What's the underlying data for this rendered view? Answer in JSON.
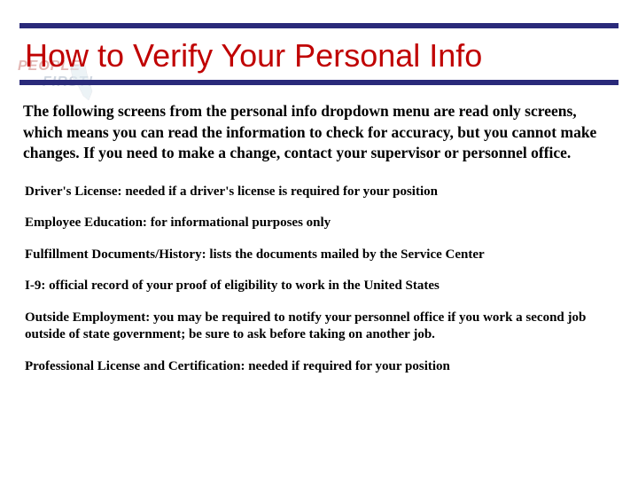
{
  "watermark": {
    "line1": "PEOPLE",
    "line2": "FIRST!"
  },
  "title": "How to Verify Your Personal Info",
  "intro": "The following screens from the personal info dropdown menu are read only screens, which means you can read the information to check for accuracy, but you cannot make changes.  If you need to make a change, contact your supervisor or personnel office.",
  "items": [
    {
      "term": "Driver's License:",
      "desc": " needed if a driver's license is required for your position"
    },
    {
      "term": "Employee Education:",
      "desc": " for informational purposes only"
    },
    {
      "term": "Fulfillment Documents/History:",
      "desc": " lists the documents mailed by the Service Center"
    },
    {
      "term": "I-9:",
      "desc": " official record of your proof of eligibility to work in the United States"
    },
    {
      "term": "Outside Employment:",
      "desc": " you may be required to notify your personnel office if you work a second job outside of state government; be sure to ask before taking on another job."
    },
    {
      "term": "Professional License and Certification:",
      "desc": " needed if required for your position"
    }
  ]
}
